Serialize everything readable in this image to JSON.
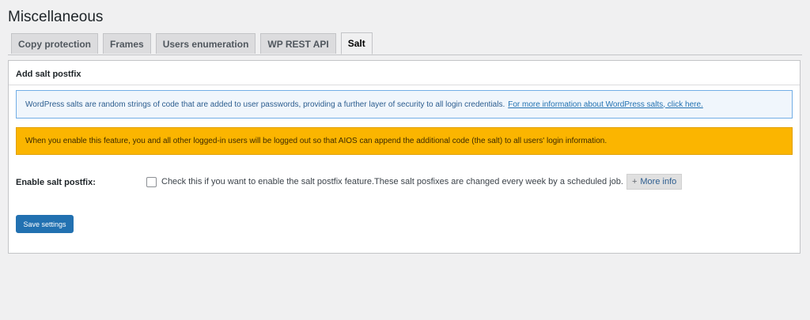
{
  "page": {
    "title": "Miscellaneous"
  },
  "tabs": [
    {
      "label": "Copy protection",
      "active": false
    },
    {
      "label": "Frames",
      "active": false
    },
    {
      "label": "Users enumeration",
      "active": false
    },
    {
      "label": "WP REST API",
      "active": false
    },
    {
      "label": "Salt",
      "active": true
    }
  ],
  "panel": {
    "heading": "Add salt postfix",
    "info_notice": {
      "text": "WordPress salts are random strings of code that are added to user passwords, providing a further layer of security to all login credentials.",
      "link_text": "For more information about WordPress salts, click here."
    },
    "warning_notice": {
      "text": "When you enable this feature, you and all other logged-in users will be logged out so that AIOS can append the additional code (the salt) to all users' login information."
    },
    "setting": {
      "label": "Enable salt postfix:",
      "checked": false,
      "description": "Check this if you want to enable the salt postfix feature.These salt posfixes are changed every week by a scheduled job.",
      "more_info_plus": "+",
      "more_info_label": "More info"
    },
    "save_label": "Save settings"
  },
  "colors": {
    "primary": "#2271b1",
    "warning": "#fbb500",
    "info_bg": "#f0f6fc",
    "info_border": "#72aee6"
  }
}
